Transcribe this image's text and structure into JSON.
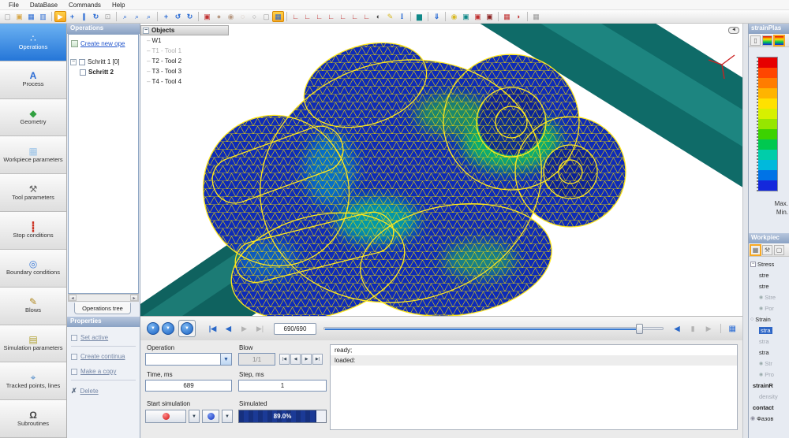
{
  "menu": {
    "items": [
      "File",
      "DataBase",
      "Commands",
      "Help"
    ]
  },
  "toolbar": {
    "icons": [
      {
        "name": "new-file-icon",
        "glyph": "▢"
      },
      {
        "name": "open-file-icon",
        "glyph": "▣"
      },
      {
        "name": "save-icon",
        "glyph": "▦"
      },
      {
        "name": "save-as-icon",
        "glyph": "▥"
      },
      {
        "name": "start-simulation-icon",
        "glyph": "▶"
      },
      {
        "name": "add-operation-icon",
        "glyph": "+"
      },
      {
        "name": "pause-icon",
        "glyph": "∥"
      },
      {
        "name": "refresh-icon",
        "glyph": "↻"
      },
      {
        "name": "fit-view-icon",
        "glyph": "⊡"
      },
      {
        "name": "zoom-in-icon",
        "glyph": "⌕"
      },
      {
        "name": "zoom-out-icon",
        "glyph": "⌕"
      },
      {
        "name": "zoom-window-icon",
        "glyph": "⌕"
      },
      {
        "name": "pan-icon",
        "glyph": "+"
      },
      {
        "name": "rotate-ccw-icon",
        "glyph": "↺"
      },
      {
        "name": "rotate-cw-icon",
        "glyph": "↻"
      },
      {
        "name": "image-icon",
        "glyph": "▣"
      },
      {
        "name": "shaded-view-icon",
        "glyph": "●"
      },
      {
        "name": "shaded-edges-view-icon",
        "glyph": "◉"
      },
      {
        "name": "wireframe-view-icon",
        "glyph": "◌"
      },
      {
        "name": "transparent-view-icon",
        "glyph": "○"
      },
      {
        "name": "bounding-box-icon",
        "glyph": "▢"
      },
      {
        "name": "mesh-view-icon",
        "glyph": "▦"
      },
      {
        "name": "view-front-icon",
        "glyph": "∟"
      },
      {
        "name": "view-back-icon",
        "glyph": "∟"
      },
      {
        "name": "view-left-icon",
        "glyph": "∟"
      },
      {
        "name": "view-right-icon",
        "glyph": "∟"
      },
      {
        "name": "view-top-icon",
        "glyph": "∟"
      },
      {
        "name": "view-bottom-icon",
        "glyph": "∟"
      },
      {
        "name": "view-iso-icon",
        "glyph": "∟"
      },
      {
        "name": "contrast-icon",
        "glyph": "◐"
      },
      {
        "name": "measure-icon",
        "glyph": "✎"
      },
      {
        "name": "text-icon",
        "glyph": "I"
      },
      {
        "name": "chart-icon",
        "glyph": "▆"
      },
      {
        "name": "save-result-icon",
        "glyph": "⇓"
      },
      {
        "name": "license-icon",
        "glyph": "◉"
      },
      {
        "name": "database-tool-1-icon",
        "glyph": "▣"
      },
      {
        "name": "database-tool-2-icon",
        "glyph": "▣"
      },
      {
        "name": "database-tool-3-icon",
        "glyph": "▣"
      },
      {
        "name": "window-layout-icon",
        "glyph": "▦"
      },
      {
        "name": "qform-logo-icon",
        "glyph": "◗"
      },
      {
        "name": "screen-capture-icon",
        "glyph": "▦"
      }
    ]
  },
  "sidebar": {
    "items": [
      {
        "label": "Operations",
        "icon": "∴"
      },
      {
        "label": "Process",
        "icon": "A"
      },
      {
        "label": "Geometry",
        "icon": "◆"
      },
      {
        "label": "Workpiece parameters",
        "icon": "▦"
      },
      {
        "label": "Tool parameters",
        "icon": "⚒"
      },
      {
        "label": "Stop conditions",
        "icon": "┋"
      },
      {
        "label": "Boundary conditions",
        "icon": "◎"
      },
      {
        "label": "Blows",
        "icon": "✎"
      },
      {
        "label": "Simulation parameters",
        "icon": "▤"
      },
      {
        "label": "Tracked points, lines",
        "icon": "⌖"
      },
      {
        "label": "Subroutines",
        "icon": "Ω"
      }
    ]
  },
  "operations_panel": {
    "title": "Operations",
    "create_label": "Create new ope",
    "node1": "Schritt 1 [0]",
    "node2": "Schritt 2",
    "tab_label": "Operations tree"
  },
  "properties_panel": {
    "title": "Properties",
    "actions": [
      "Set active",
      "Create continua",
      "Make a copy",
      "Delete"
    ],
    "delete_icon": "✗"
  },
  "objects_panel": {
    "title": "Objects",
    "items": [
      "W1",
      "T1 - Tool 1",
      "T2 - Tool 2",
      "T3 - Tool 3",
      "T4 - Tool 4"
    ]
  },
  "playback": {
    "buttons": [
      {
        "name": "show-initial-result-button",
        "glyph": "▼"
      },
      {
        "name": "show-intermediate-result-button",
        "glyph": "▼"
      },
      {
        "name": "show-final-result-button",
        "glyph": "▼"
      }
    ],
    "skip_start": "|◀",
    "step_back": "◀",
    "step_forward": "▶",
    "skip_end": "▶|",
    "frame_value": "690/690",
    "nav_left": "◀",
    "nav_mid": "▮",
    "nav_right": "▶",
    "save_glyph": "▦"
  },
  "controls": {
    "operation_label": "Operation",
    "blow_label": "Blow",
    "blow_value": "1/1",
    "blow_nav": [
      "|◀",
      "◀",
      "▶",
      "▶|"
    ],
    "time_label": "Time, ms",
    "time_value": "689",
    "step_label": "Step, ms",
    "step_value": "1",
    "start_label": "Start simulation",
    "simulated_label": "Simulated",
    "progress_text": "89.0%",
    "progress_width": "89%",
    "dropdown_glyph": "▼"
  },
  "messages": {
    "rows": [
      "ready;",
      "loaded:"
    ]
  },
  "scale_panel": {
    "title": "strainPlas",
    "toolbar": [
      {
        "name": "fringe-none-icon",
        "glyph": "▯"
      },
      {
        "name": "colorbar-icon",
        "glyph": ""
      },
      {
        "name": "colorbar-settings-icon",
        "glyph": ""
      }
    ],
    "colors": [
      "#e60000",
      "#ff4600",
      "#ff7d00",
      "#ffb400",
      "#ffe100",
      "#d7f000",
      "#96e600",
      "#3cd200",
      "#00c850",
      "#00cdaa",
      "#00b9dc",
      "#0073e6",
      "#1428dc"
    ],
    "max_label": "Max.",
    "min_label": "Min."
  },
  "workpiece_panel": {
    "title": "Workpiec",
    "toolbar": [
      {
        "name": "fields-database-icon",
        "glyph": "▦"
      },
      {
        "name": "tool-fields-icon",
        "glyph": "⚒"
      },
      {
        "name": "empty-field-icon",
        "glyph": "▢"
      }
    ],
    "tree": [
      {
        "label": "Stress"
      },
      {
        "label": "stre"
      },
      {
        "label": "stre"
      },
      {
        "label": "Stre"
      },
      {
        "label": "Por"
      },
      {
        "label": "Strain"
      },
      {
        "label": "stra",
        "selected": true
      },
      {
        "label": "stra"
      },
      {
        "label": "stra"
      },
      {
        "label": "Str"
      },
      {
        "label": "Pro"
      },
      {
        "label": "strainR"
      },
      {
        "label": "density"
      },
      {
        "label": "contact"
      },
      {
        "label": "Фазов"
      }
    ]
  }
}
